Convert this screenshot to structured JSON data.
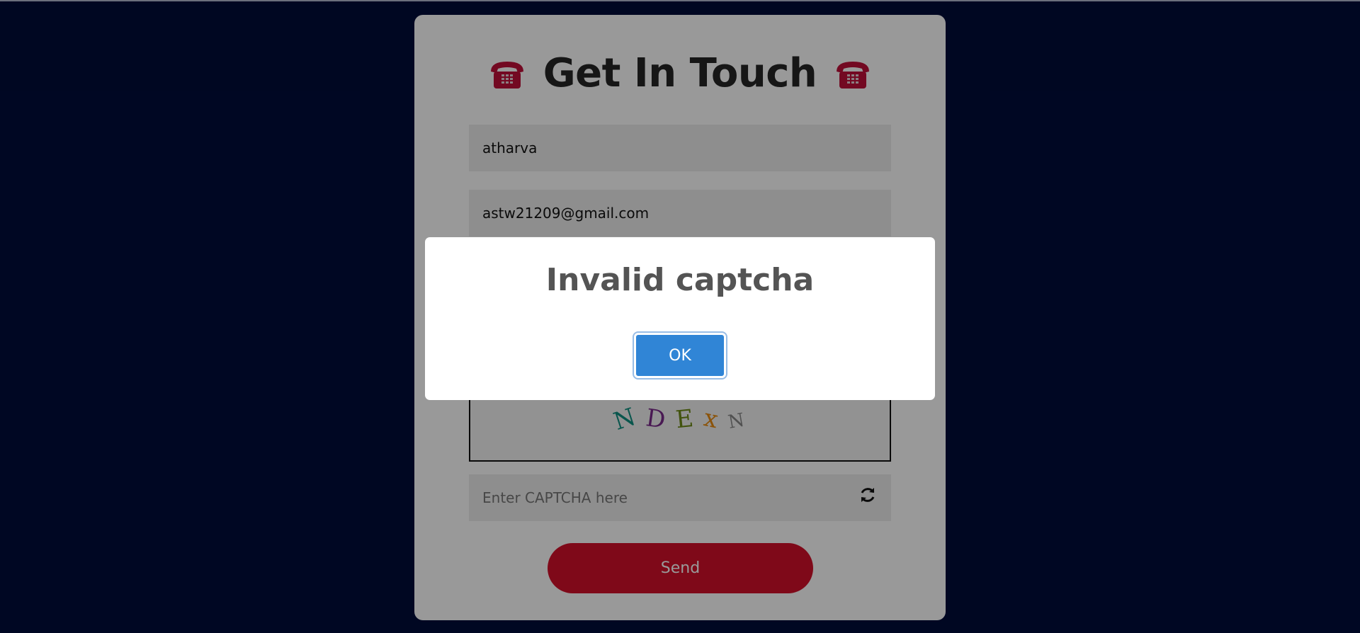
{
  "form": {
    "title": "Get In Touch",
    "title_icon": "telephone-icon",
    "name_value": "atharva",
    "email_value": "astw21209@gmail.com",
    "captcha_letters": [
      "N",
      "D",
      "E",
      "x",
      "N"
    ],
    "captcha_placeholder": "Enter CAPTCHA here",
    "refresh_icon": "refresh-icon",
    "send_label": "Send"
  },
  "modal": {
    "title": "Invalid captcha",
    "ok_label": "OK"
  },
  "colors": {
    "page_background": "#000c3a",
    "send_button": "#d4102a",
    "ok_button": "#3085d6",
    "phone_icon": "#c0103a"
  }
}
